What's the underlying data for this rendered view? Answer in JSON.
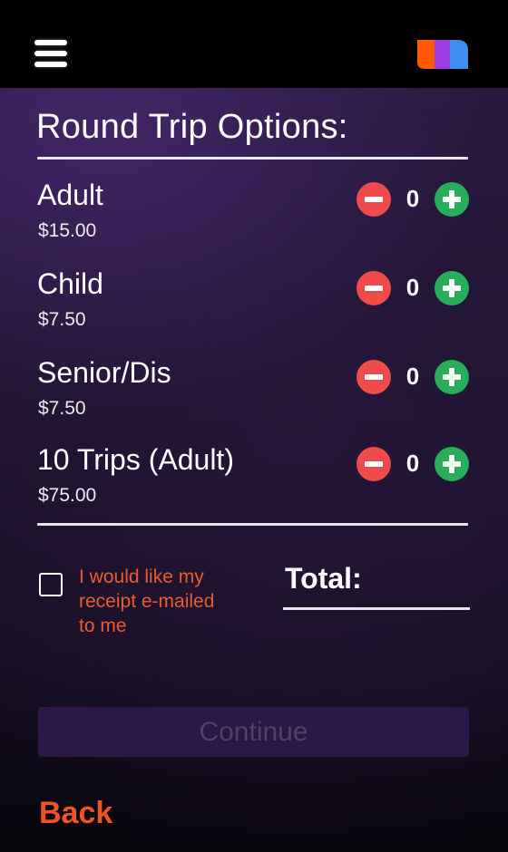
{
  "header": {
    "menu_icon": "hamburger-menu-icon",
    "logo_icon": "brand-logo-icon",
    "logo_colors": [
      "#ff5a00",
      "#9b3be0",
      "#3f8ff0"
    ]
  },
  "section": {
    "title": "Round Trip Options:"
  },
  "options": [
    {
      "name": "Adult",
      "price": "$15.00",
      "quantity": "0"
    },
    {
      "name": "Child",
      "price": "$7.50",
      "quantity": "0"
    },
    {
      "name": "Senior/Dis",
      "price": "$7.50",
      "quantity": "0"
    },
    {
      "name": "10 Trips (Adult)",
      "price": "$75.00",
      "quantity": "0"
    }
  ],
  "stepper": {
    "minus_icon": "minus-icon",
    "plus_icon": "plus-icon",
    "minus_color": "#f04a4a",
    "plus_color": "#27ae5a"
  },
  "receipt": {
    "label": "I would like my receipt e-mailed to me",
    "checked": false,
    "color": "#ee5a2c"
  },
  "total": {
    "label": "Total:"
  },
  "actions": {
    "continue_label": "Continue",
    "back_label": "Back"
  },
  "colors": {
    "accent": "#ef5326",
    "button_bg": "#2b1848",
    "button_text": "#4d4466"
  }
}
